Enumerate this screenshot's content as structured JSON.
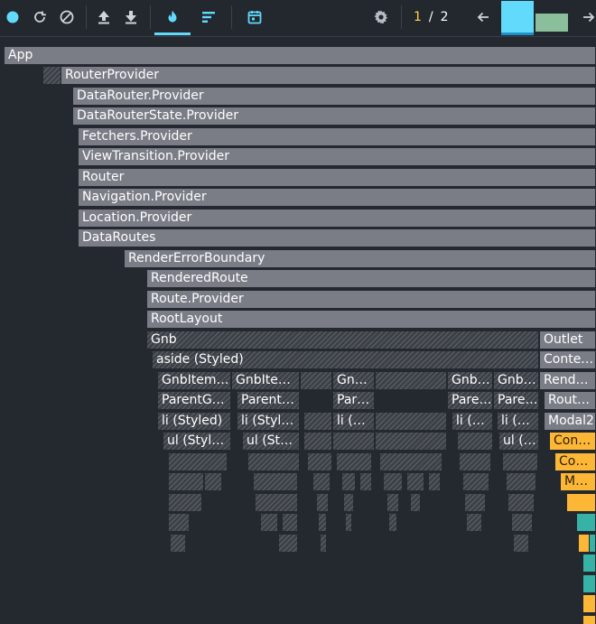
{
  "toolbar": {
    "record_icon": "record-dot-icon",
    "reload_icon": "reload-icon",
    "clear_icon": "clear-icon",
    "load_icon": "upload-icon",
    "save_icon": "download-icon",
    "flamegraph_icon": "flame-icon",
    "ranked_icon": "ranked-icon",
    "timeline_icon": "calendar-icon",
    "settings_icon": "gear-icon",
    "accent_color": "#61dafb"
  },
  "commit_nav": {
    "current": "1",
    "separator": "/",
    "total": "2",
    "prev_icon": "arrow-left-icon",
    "next_icon": "arrow-right-icon"
  },
  "colors": {
    "background": "#24282f",
    "did_not_render": "#7a7d86",
    "rendered_yellow": "#fdb736",
    "rendered_teal": "#37b2a6"
  },
  "flamegraph": {
    "app": "App",
    "router_provider": "RouterProvider",
    "data_router_provider": "DataRouter.Provider",
    "data_router_state_provider": "DataRouterState.Provider",
    "fetchers_provider": "Fetchers.Provider",
    "view_transition_provider": "ViewTransition.Provider",
    "router": "Router",
    "navigation_provider": "Navigation.Provider",
    "location_provider": "Location.Provider",
    "data_routes": "DataRoutes",
    "render_error_boundary": "RenderErrorBoundary",
    "rendered_route": "RenderedRoute",
    "route_provider": "Route.Provider",
    "root_layout": "RootLayout",
    "gnb": "Gnb",
    "outlet": "Outlet",
    "aside": "aside (Styled)",
    "context_provider": "Contex…",
    "gnb_item_1": "GnbItem…",
    "gnb_item_2": "GnbIte…",
    "gnb_item_3": "Gn…",
    "gnb_item_4": "Gnb…",
    "gnb_item_5": "Gnb…",
    "rendered_route_2": "Render…",
    "parent_g_1": "ParentG…",
    "parent_2": "Parent…",
    "par_3": "Par…",
    "pare_4": "Pare…",
    "pare_5": "Pare…",
    "route_provider_2": "Route…",
    "li_1": "li (Styled)",
    "li_2": "li (Style…",
    "li_3": "li (…",
    "li_4": "li (…",
    "li_5": "li (…",
    "modal2": "Modal2",
    "ul_1": "ul (Styled)",
    "ul_2": "ul (Sty…",
    "ul_3": "ul (…",
    "confi": "Confi…",
    "con": "Con…",
    "mo": "Mo…"
  }
}
